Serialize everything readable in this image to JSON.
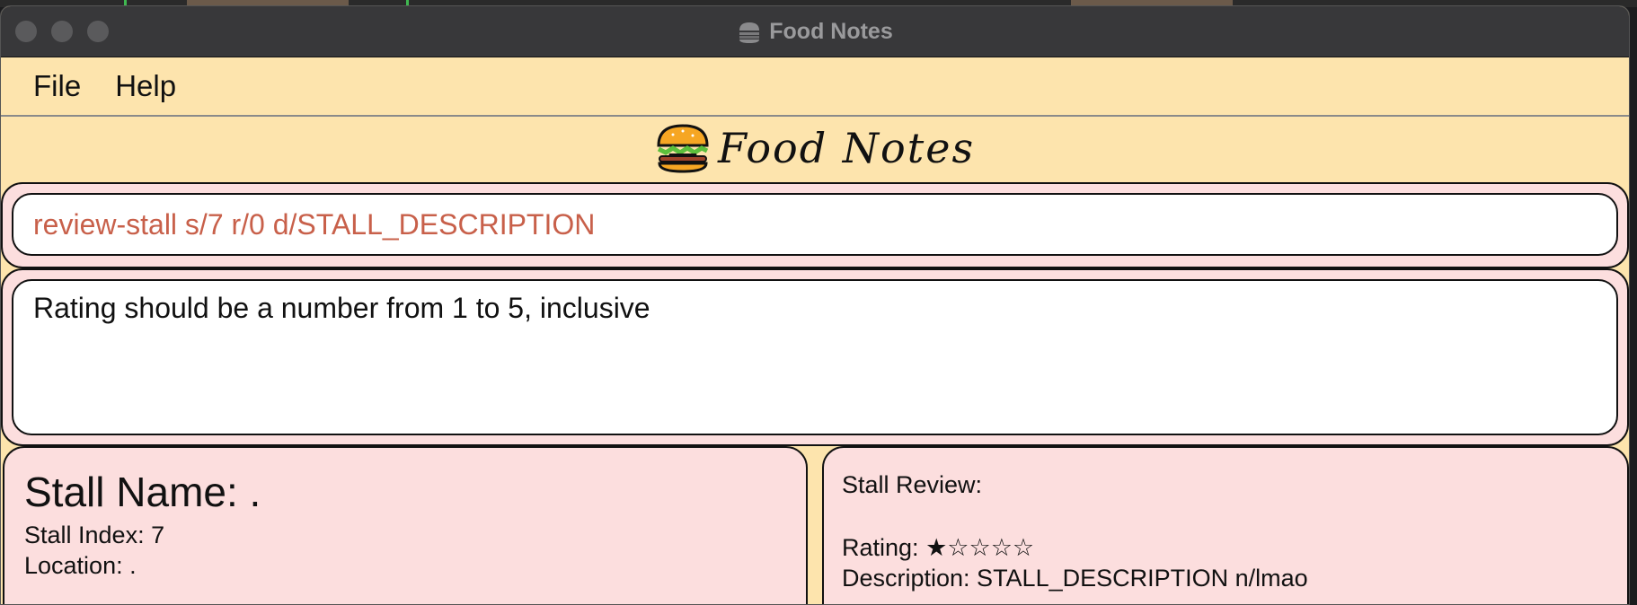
{
  "window": {
    "title": "Food Notes",
    "title_icon": "burger-icon"
  },
  "menu": {
    "items": [
      "File",
      "Help"
    ]
  },
  "banner": {
    "logo_icon": "burger-icon",
    "text": "Food Notes"
  },
  "command_box": {
    "value": "review-stall s/7 r/0 d/STALL_DESCRIPTION"
  },
  "result_display": {
    "text": "Rating should be a number from 1 to 5, inclusive"
  },
  "stall_card": {
    "name": "Stall Name: .",
    "index": "Stall Index: 7",
    "location": "Location: ."
  },
  "review_card": {
    "heading": "Stall Review:",
    "rating_label": "Rating:",
    "rating_stars": "★☆☆☆☆",
    "rating_value": 1,
    "rating_max": 5,
    "description": "Description: STALL_DESCRIPTION n/lmao"
  },
  "colors": {
    "app_background": "#fde4ad",
    "panel_background": "#fcdede",
    "command_text": "#c8604a",
    "titlebar": "#38383a"
  }
}
